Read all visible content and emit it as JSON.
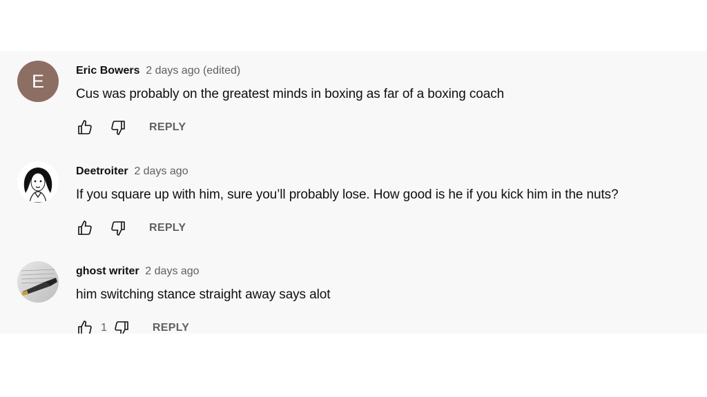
{
  "comments": [
    {
      "author": "Eric Bowers",
      "meta": "2 days ago (edited)",
      "avatar_letter": "E",
      "text": "Cus was probably on the greatest minds in boxing as far of a boxing coach",
      "likes": "",
      "reply_label": "REPLY"
    },
    {
      "author": "Deetroiter",
      "meta": "2 days ago",
      "avatar_letter": "",
      "text": "If you square up with him, sure you’ll probably lose. How good is he if you kick him in the nuts?",
      "likes": "",
      "reply_label": "REPLY"
    },
    {
      "author": "ghost writer",
      "meta": "2 days ago",
      "avatar_letter": "",
      "text": "him switching stance straight away says alot",
      "likes": "1",
      "reply_label": "REPLY"
    }
  ],
  "colors": {
    "panel_bg": "#f8f8f8",
    "avatar_e": "#8d6e63",
    "meta_text": "#606060",
    "body_text": "#0f0f0f"
  }
}
